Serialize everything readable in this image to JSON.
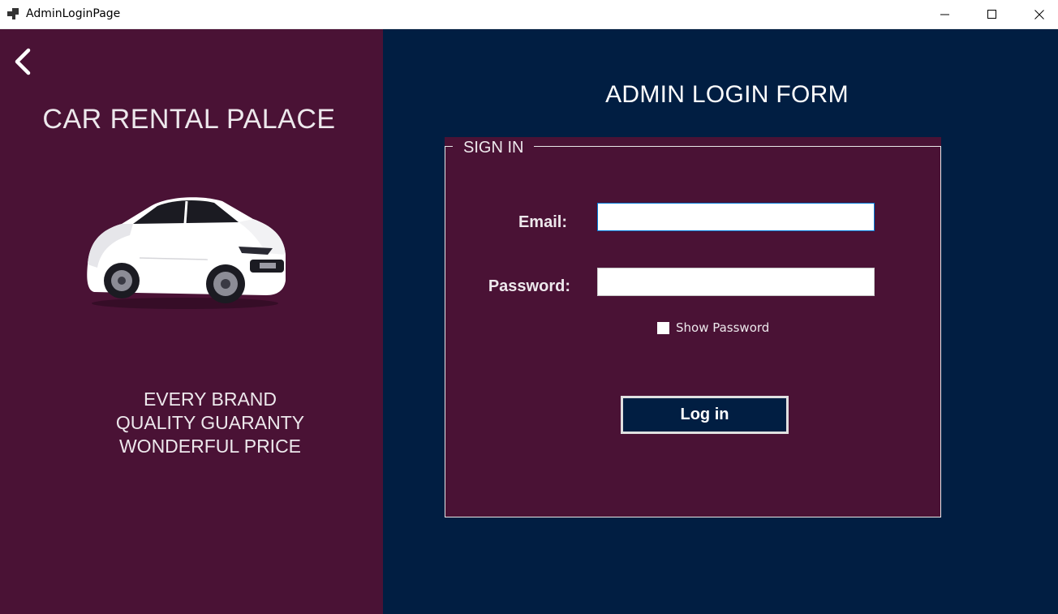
{
  "window": {
    "title": "AdminLoginPage",
    "controls": [
      "minimize-icon",
      "maximize-icon",
      "close-icon"
    ]
  },
  "left_panel": {
    "background": "#4a1235",
    "back_icon": "chevron-left-icon",
    "brand_title": "CAR RENTAL PALACE",
    "car_image": "white-sedan",
    "taglines": [
      "EVERY BRAND",
      "QUALITY GUARANTY",
      "WONDERFUL PRICE"
    ]
  },
  "right_panel": {
    "background": "#011e42",
    "form_title": "ADMIN LOGIN FORM",
    "group_title": "SIGN IN",
    "email_label": "Email:",
    "email_value": "",
    "password_label": "Password:",
    "password_value": "",
    "show_password_label": "Show Password",
    "show_password_checked": false,
    "login_button": "Log in"
  },
  "colors": {
    "accent_plum": "#4a1235",
    "accent_navy": "#011e42",
    "text_light": "#ede8ec",
    "focus_border": "#0078d7"
  }
}
